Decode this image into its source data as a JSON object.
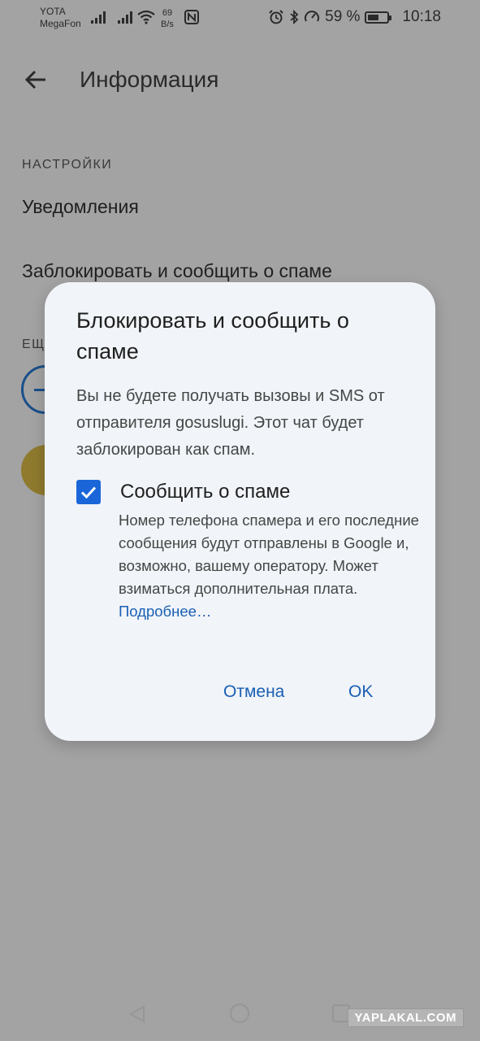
{
  "status_bar": {
    "carrier1": "YOTA",
    "carrier2": "MegaFon",
    "speed_value": "69",
    "speed_unit": "B/s",
    "battery_text": "59 %",
    "battery_level": 0.59,
    "time": "10:18",
    "icons": [
      "signal-icon",
      "signal-icon",
      "wifi-icon",
      "nfc-icon",
      "alarm-icon",
      "bluetooth-icon",
      "data-saver-icon",
      "battery-icon"
    ]
  },
  "app_bar": {
    "title": "Информация"
  },
  "settings": {
    "header": "НАСТРОЙКИ",
    "notifications": "Уведомления",
    "block_spam": "Заблокировать и сообщить о спаме",
    "section2_header_partial": "ЕЩ"
  },
  "dialog": {
    "title": "Блокировать и сообщить о спаме",
    "body": "Вы не будете получать вызовы и SMS от отправителя gosuslugi. Этот чат будет заблокирован как спам.",
    "checkbox_checked": true,
    "checkbox_label": "Сообщить о спаме",
    "checkbox_desc": "Номер телефона спамера и его последние сообщения будут отправлены в Google и, возможно, вашему оператору. Может взиматься дополнительная плата.",
    "more_link": "Подробнее…",
    "cancel": "Отмена",
    "ok": "OK"
  },
  "watermark": "YAPLAKAL.COM",
  "colors": {
    "accent": "#1a5fb4",
    "checkbox": "#1a66d9",
    "scrim_background": "#a3a3a3",
    "dialog_background": "#f1f4f8",
    "avatar": "#8f7a2e"
  }
}
